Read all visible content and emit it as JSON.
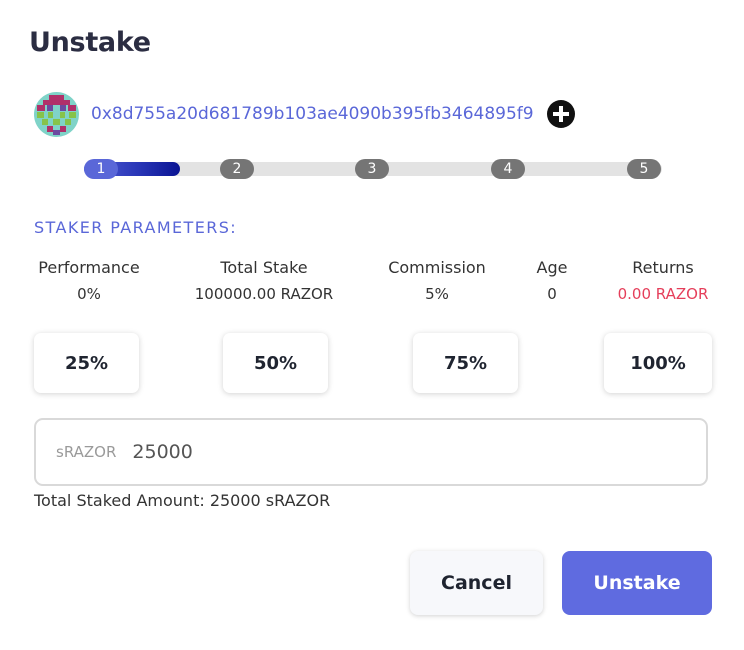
{
  "dialog": {
    "title": "Unstake"
  },
  "account": {
    "address": "0x8d755a20d681789b103ae4090b395fb3464895f9",
    "avatar_icon": "identicon-avatar",
    "add_icon": "plus-circle-icon"
  },
  "stepper": {
    "steps": [
      "1",
      "2",
      "3",
      "4",
      "5"
    ],
    "current_step": 1,
    "progress_fraction": 0.17
  },
  "staker_parameters": {
    "heading": "STAKER PARAMETERS:",
    "items": [
      {
        "label": "Performance",
        "value": "0%"
      },
      {
        "label": "Total Stake",
        "value": "100000.00 RAZOR"
      },
      {
        "label": "Commission",
        "value": "5%"
      },
      {
        "label": "Age",
        "value": "0"
      },
      {
        "label": "Returns",
        "value": "0.00 RAZOR"
      }
    ]
  },
  "percent_buttons": [
    "25%",
    "50%",
    "75%",
    "100%"
  ],
  "amount_input": {
    "prefix": "sRAZOR",
    "value": "25000"
  },
  "total_staked": "Total Staked Amount: 25000 sRAZOR",
  "actions": {
    "cancel_label": "Cancel",
    "unstake_label": "Unstake"
  },
  "colors": {
    "accent": "#5a67d8",
    "returns_red": "#e53e5a",
    "primary_button": "#5f6be0"
  }
}
